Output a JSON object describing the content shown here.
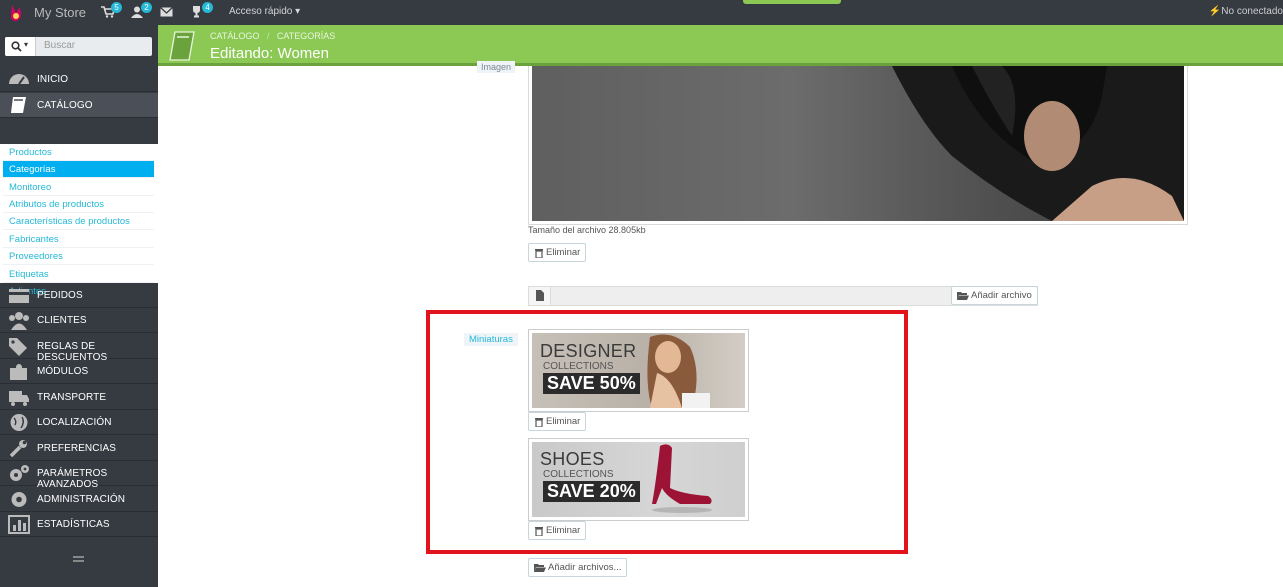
{
  "topbar": {
    "store_name": "My Store",
    "badges": {
      "cart": "5",
      "customers": "2",
      "trophy": "4"
    },
    "quick_access": "Acceso rápido",
    "status": "No conectado",
    "icons": [
      "prestashop-logo-icon",
      "cart-icon",
      "user-icon",
      "envelope-icon",
      "trophy-icon",
      "caret-down-icon",
      "unplugged-icon"
    ]
  },
  "sidebar": {
    "search_placeholder": "Buscar",
    "menu": [
      {
        "label": "INICIO",
        "icon": "dashboard-icon"
      },
      {
        "label": "CATÁLOGO",
        "icon": "book-icon",
        "active": true
      },
      {
        "label": "PEDIDOS",
        "icon": "credit-card-icon"
      },
      {
        "label": "CLIENTES",
        "icon": "users-icon"
      },
      {
        "label": "REGLAS DE DESCUENTOS",
        "icon": "tags-icon"
      },
      {
        "label": "MÓDULOS",
        "icon": "puzzle-icon"
      },
      {
        "label": "TRANSPORTE",
        "icon": "truck-icon"
      },
      {
        "label": "LOCALIZACIÓN",
        "icon": "globe-icon"
      },
      {
        "label": "PREFERENCIAS",
        "icon": "wrench-icon"
      },
      {
        "label": "PARÁMETROS AVANZADOS",
        "icon": "cogs-icon"
      },
      {
        "label": "ADMINISTRACIÓN",
        "icon": "cog-icon"
      },
      {
        "label": "ESTADÍSTICAS",
        "icon": "bar-chart-icon"
      }
    ],
    "submenu": [
      "Productos",
      "Categorías",
      "Monitoreo",
      "Atributos de productos",
      "Características de productos",
      "Fabricantes",
      "Proveedores",
      "Etiquetas",
      "Adjuntos"
    ],
    "active_submenu": "Categorías"
  },
  "header": {
    "breadcrumb": [
      "CATÁLOGO",
      "/",
      "CATEGORÍAS"
    ],
    "title": "Editando: Women"
  },
  "content": {
    "image_label": "Imagen",
    "file_size": "Tamaño del archivo 28.805kb",
    "delete_label": "Eliminar",
    "add_file_label": "Añadir archivo",
    "thumbnails_label": "Miniaturas",
    "thumbnails": [
      {
        "line1": "DESIGNER",
        "line2": "COLLECTIONS",
        "line3": "SAVE 50%"
      },
      {
        "line1": "SHOES",
        "line2": "COLLECTIONS",
        "line3": "SAVE 20%"
      }
    ],
    "add_files_label": "Añadir archivos..."
  },
  "colors": {
    "topbar_bg": "#363a41",
    "sidebar_bg": "#363a41",
    "header_green": "#8bc954",
    "accent_blue": "#25b9d7",
    "highlight_red": "#e3131b"
  }
}
